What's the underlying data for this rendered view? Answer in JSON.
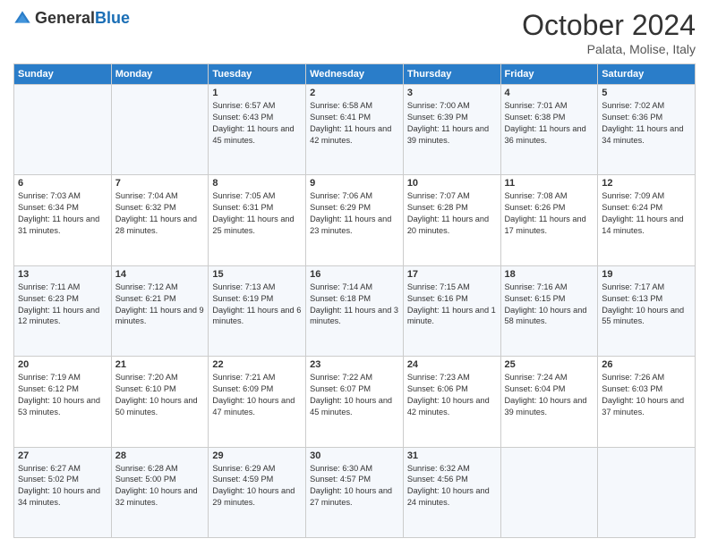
{
  "header": {
    "logo_general": "General",
    "logo_blue": "Blue",
    "month": "October 2024",
    "location": "Palata, Molise, Italy"
  },
  "days_of_week": [
    "Sunday",
    "Monday",
    "Tuesday",
    "Wednesday",
    "Thursday",
    "Friday",
    "Saturday"
  ],
  "weeks": [
    [
      {
        "day": "",
        "sunrise": "",
        "sunset": "",
        "daylight": ""
      },
      {
        "day": "",
        "sunrise": "",
        "sunset": "",
        "daylight": ""
      },
      {
        "day": "1",
        "sunrise": "Sunrise: 6:57 AM",
        "sunset": "Sunset: 6:43 PM",
        "daylight": "Daylight: 11 hours and 45 minutes."
      },
      {
        "day": "2",
        "sunrise": "Sunrise: 6:58 AM",
        "sunset": "Sunset: 6:41 PM",
        "daylight": "Daylight: 11 hours and 42 minutes."
      },
      {
        "day": "3",
        "sunrise": "Sunrise: 7:00 AM",
        "sunset": "Sunset: 6:39 PM",
        "daylight": "Daylight: 11 hours and 39 minutes."
      },
      {
        "day": "4",
        "sunrise": "Sunrise: 7:01 AM",
        "sunset": "Sunset: 6:38 PM",
        "daylight": "Daylight: 11 hours and 36 minutes."
      },
      {
        "day": "5",
        "sunrise": "Sunrise: 7:02 AM",
        "sunset": "Sunset: 6:36 PM",
        "daylight": "Daylight: 11 hours and 34 minutes."
      }
    ],
    [
      {
        "day": "6",
        "sunrise": "Sunrise: 7:03 AM",
        "sunset": "Sunset: 6:34 PM",
        "daylight": "Daylight: 11 hours and 31 minutes."
      },
      {
        "day": "7",
        "sunrise": "Sunrise: 7:04 AM",
        "sunset": "Sunset: 6:32 PM",
        "daylight": "Daylight: 11 hours and 28 minutes."
      },
      {
        "day": "8",
        "sunrise": "Sunrise: 7:05 AM",
        "sunset": "Sunset: 6:31 PM",
        "daylight": "Daylight: 11 hours and 25 minutes."
      },
      {
        "day": "9",
        "sunrise": "Sunrise: 7:06 AM",
        "sunset": "Sunset: 6:29 PM",
        "daylight": "Daylight: 11 hours and 23 minutes."
      },
      {
        "day": "10",
        "sunrise": "Sunrise: 7:07 AM",
        "sunset": "Sunset: 6:28 PM",
        "daylight": "Daylight: 11 hours and 20 minutes."
      },
      {
        "day": "11",
        "sunrise": "Sunrise: 7:08 AM",
        "sunset": "Sunset: 6:26 PM",
        "daylight": "Daylight: 11 hours and 17 minutes."
      },
      {
        "day": "12",
        "sunrise": "Sunrise: 7:09 AM",
        "sunset": "Sunset: 6:24 PM",
        "daylight": "Daylight: 11 hours and 14 minutes."
      }
    ],
    [
      {
        "day": "13",
        "sunrise": "Sunrise: 7:11 AM",
        "sunset": "Sunset: 6:23 PM",
        "daylight": "Daylight: 11 hours and 12 minutes."
      },
      {
        "day": "14",
        "sunrise": "Sunrise: 7:12 AM",
        "sunset": "Sunset: 6:21 PM",
        "daylight": "Daylight: 11 hours and 9 minutes."
      },
      {
        "day": "15",
        "sunrise": "Sunrise: 7:13 AM",
        "sunset": "Sunset: 6:19 PM",
        "daylight": "Daylight: 11 hours and 6 minutes."
      },
      {
        "day": "16",
        "sunrise": "Sunrise: 7:14 AM",
        "sunset": "Sunset: 6:18 PM",
        "daylight": "Daylight: 11 hours and 3 minutes."
      },
      {
        "day": "17",
        "sunrise": "Sunrise: 7:15 AM",
        "sunset": "Sunset: 6:16 PM",
        "daylight": "Daylight: 11 hours and 1 minute."
      },
      {
        "day": "18",
        "sunrise": "Sunrise: 7:16 AM",
        "sunset": "Sunset: 6:15 PM",
        "daylight": "Daylight: 10 hours and 58 minutes."
      },
      {
        "day": "19",
        "sunrise": "Sunrise: 7:17 AM",
        "sunset": "Sunset: 6:13 PM",
        "daylight": "Daylight: 10 hours and 55 minutes."
      }
    ],
    [
      {
        "day": "20",
        "sunrise": "Sunrise: 7:19 AM",
        "sunset": "Sunset: 6:12 PM",
        "daylight": "Daylight: 10 hours and 53 minutes."
      },
      {
        "day": "21",
        "sunrise": "Sunrise: 7:20 AM",
        "sunset": "Sunset: 6:10 PM",
        "daylight": "Daylight: 10 hours and 50 minutes."
      },
      {
        "day": "22",
        "sunrise": "Sunrise: 7:21 AM",
        "sunset": "Sunset: 6:09 PM",
        "daylight": "Daylight: 10 hours and 47 minutes."
      },
      {
        "day": "23",
        "sunrise": "Sunrise: 7:22 AM",
        "sunset": "Sunset: 6:07 PM",
        "daylight": "Daylight: 10 hours and 45 minutes."
      },
      {
        "day": "24",
        "sunrise": "Sunrise: 7:23 AM",
        "sunset": "Sunset: 6:06 PM",
        "daylight": "Daylight: 10 hours and 42 minutes."
      },
      {
        "day": "25",
        "sunrise": "Sunrise: 7:24 AM",
        "sunset": "Sunset: 6:04 PM",
        "daylight": "Daylight: 10 hours and 39 minutes."
      },
      {
        "day": "26",
        "sunrise": "Sunrise: 7:26 AM",
        "sunset": "Sunset: 6:03 PM",
        "daylight": "Daylight: 10 hours and 37 minutes."
      }
    ],
    [
      {
        "day": "27",
        "sunrise": "Sunrise: 6:27 AM",
        "sunset": "Sunset: 5:02 PM",
        "daylight": "Daylight: 10 hours and 34 minutes."
      },
      {
        "day": "28",
        "sunrise": "Sunrise: 6:28 AM",
        "sunset": "Sunset: 5:00 PM",
        "daylight": "Daylight: 10 hours and 32 minutes."
      },
      {
        "day": "29",
        "sunrise": "Sunrise: 6:29 AM",
        "sunset": "Sunset: 4:59 PM",
        "daylight": "Daylight: 10 hours and 29 minutes."
      },
      {
        "day": "30",
        "sunrise": "Sunrise: 6:30 AM",
        "sunset": "Sunset: 4:57 PM",
        "daylight": "Daylight: 10 hours and 27 minutes."
      },
      {
        "day": "31",
        "sunrise": "Sunrise: 6:32 AM",
        "sunset": "Sunset: 4:56 PM",
        "daylight": "Daylight: 10 hours and 24 minutes."
      },
      {
        "day": "",
        "sunrise": "",
        "sunset": "",
        "daylight": ""
      },
      {
        "day": "",
        "sunrise": "",
        "sunset": "",
        "daylight": ""
      }
    ]
  ]
}
